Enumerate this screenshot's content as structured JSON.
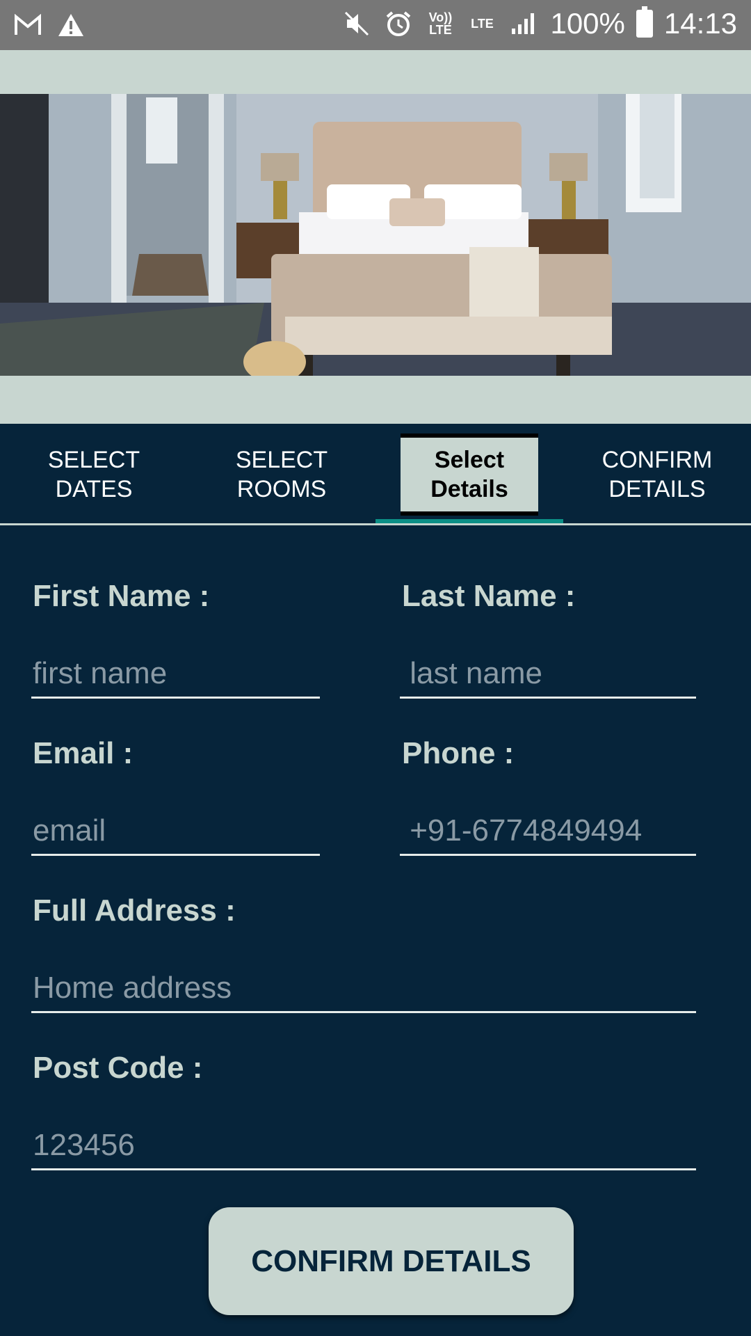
{
  "status_bar": {
    "battery": "100%",
    "time": "14:13",
    "volte_label": "Vo))\nLTE",
    "lte_label": "LTE",
    "icons": [
      "gmail-icon",
      "warning-icon",
      "mute-icon",
      "alarm-icon",
      "volte-icon",
      "lte-icon",
      "signal-icon",
      "battery-icon"
    ]
  },
  "hero": {
    "image": "hotel-bedroom-photo"
  },
  "tabs": [
    {
      "label": "SELECT\nDATES",
      "active": false
    },
    {
      "label": "SELECT\nROOMS",
      "active": false
    },
    {
      "label": "Select\nDetails",
      "active": true
    },
    {
      "label": "CONFIRM\nDETAILS",
      "active": false
    }
  ],
  "form": {
    "first_name": {
      "label": "First Name :",
      "placeholder": "first name"
    },
    "last_name": {
      "label": "Last Name :",
      "placeholder": " last name"
    },
    "email": {
      "label": "Email :",
      "placeholder": "email"
    },
    "phone": {
      "label": "Phone :",
      "placeholder": " +91-6774849494"
    },
    "address": {
      "label": "Full Address :",
      "placeholder": "Home address"
    },
    "post_code": {
      "label": "Post Code :",
      "placeholder": "123456"
    }
  },
  "confirm_button": {
    "label": "CONFIRM DETAILS"
  },
  "colors": {
    "background": "#06243a",
    "accent": "#c8d6d0",
    "indicator": "#0c8f86",
    "status_bar": "#777777"
  }
}
